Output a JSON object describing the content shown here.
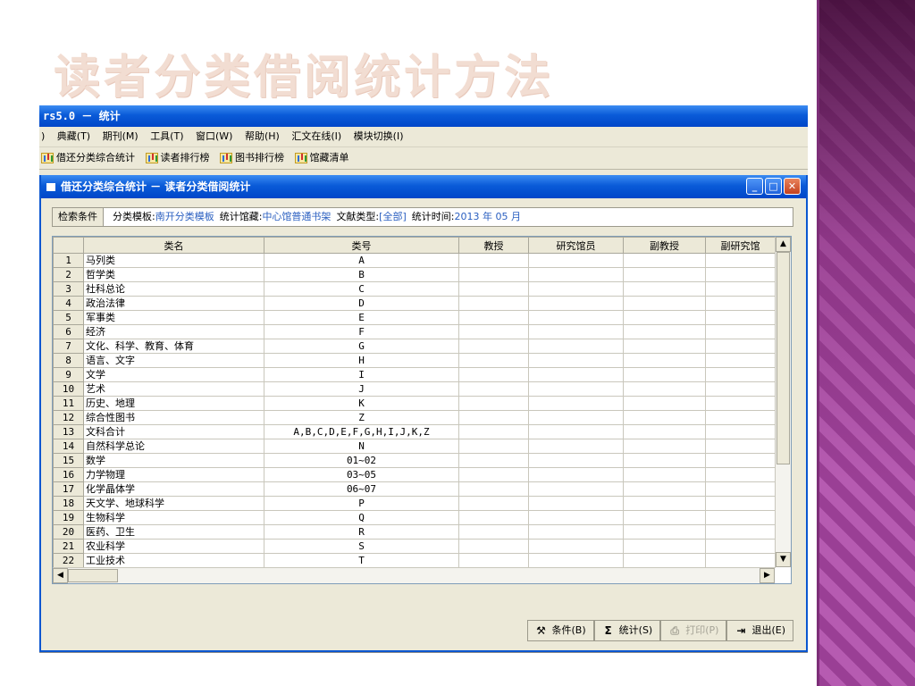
{
  "slide": {
    "title": "读者分类借阅统计方法"
  },
  "app": {
    "title": "rs5.0 － 统计",
    "menu": [
      ")",
      "典藏(T)",
      "期刊(M)",
      "工具(T)",
      "窗口(W)",
      "帮助(H)",
      "汇文在线(I)",
      "模块切换(I)"
    ],
    "toolbar": [
      "借还分类综合统计",
      "读者排行榜",
      "图书排行榜",
      "馆藏清单"
    ]
  },
  "child": {
    "title": "借还分类综合统计 － 读者分类借阅统计",
    "criteria": {
      "label": "检索条件",
      "template_key": "分类模板:",
      "template_val": "南开分类模板",
      "library_key": "统计馆藏:",
      "library_val": "中心馆普通书架",
      "doctype_key": "文献类型:",
      "doctype_val": "[全部]",
      "time_key": "统计时间:",
      "time_val": "2013 年 05 月"
    },
    "columns": [
      "",
      "类名",
      "类号",
      "教授",
      "研究馆员",
      "副教授",
      "副研究馆"
    ],
    "rows": [
      {
        "n": "1",
        "name": "马列类",
        "code": "A"
      },
      {
        "n": "2",
        "name": "哲学类",
        "code": "B"
      },
      {
        "n": "3",
        "name": "社科总论",
        "code": "C"
      },
      {
        "n": "4",
        "name": "政治法律",
        "code": "D"
      },
      {
        "n": "5",
        "name": "军事类",
        "code": "E"
      },
      {
        "n": "6",
        "name": "经济",
        "code": "F"
      },
      {
        "n": "7",
        "name": "文化、科学、教育、体育",
        "code": "G"
      },
      {
        "n": "8",
        "name": "语言、文字",
        "code": "H"
      },
      {
        "n": "9",
        "name": "文学",
        "code": "I"
      },
      {
        "n": "10",
        "name": "艺术",
        "code": "J"
      },
      {
        "n": "11",
        "name": "历史、地理",
        "code": "K"
      },
      {
        "n": "12",
        "name": "综合性图书",
        "code": "Z"
      },
      {
        "n": "13",
        "name": "文科合计",
        "code": "A,B,C,D,E,F,G,H,I,J,K,Z"
      },
      {
        "n": "14",
        "name": "自然科学总论",
        "code": "N"
      },
      {
        "n": "15",
        "name": "数学",
        "code": "01~02"
      },
      {
        "n": "16",
        "name": "力学物理",
        "code": "03~05"
      },
      {
        "n": "17",
        "name": "化学晶体学",
        "code": "06~07"
      },
      {
        "n": "18",
        "name": "天文学、地球科学",
        "code": "P"
      },
      {
        "n": "19",
        "name": "生物科学",
        "code": "Q"
      },
      {
        "n": "20",
        "name": "医药、卫生",
        "code": "R"
      },
      {
        "n": "21",
        "name": "农业科学",
        "code": "S"
      },
      {
        "n": "22",
        "name": "工业技术",
        "code": "T"
      }
    ],
    "buttons": {
      "condition": "条件(B)",
      "stat": "统计(S)",
      "print": "打印(P)",
      "exit": "退出(E)"
    }
  }
}
